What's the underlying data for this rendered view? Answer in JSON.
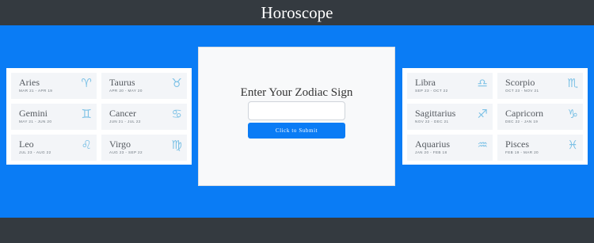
{
  "header": {
    "title": "Horoscope"
  },
  "left_panel": {
    "signs": [
      {
        "name": "Aries",
        "dates": "MAR 21 - APR 19",
        "glyph": "♈︎"
      },
      {
        "name": "Taurus",
        "dates": "APR 20 - MAY 20",
        "glyph": "♉︎"
      },
      {
        "name": "Gemini",
        "dates": "MAY 21 - JUN 20",
        "glyph": "♊︎"
      },
      {
        "name": "Cancer",
        "dates": "JUN 21 - JUL 22",
        "glyph": "♋︎"
      },
      {
        "name": "Leo",
        "dates": "JUL 23 - AUG 22",
        "glyph": "♌︎"
      },
      {
        "name": "Virgo",
        "dates": "AUG 23 - SEP 22",
        "glyph": "♍︎"
      }
    ]
  },
  "right_panel": {
    "signs": [
      {
        "name": "Libra",
        "dates": "SEP 23 - OCT 22",
        "glyph": "♎︎"
      },
      {
        "name": "Scorpio",
        "dates": "OCT 23 - NOV 21",
        "glyph": "♏︎"
      },
      {
        "name": "Sagittarius",
        "dates": "NOV 22 - DEC 21",
        "glyph": "♐︎"
      },
      {
        "name": "Capricorn",
        "dates": "DEC 22 - JAN 19",
        "glyph": "♑︎"
      },
      {
        "name": "Aquarius",
        "dates": "JAN 20 - FEB 18",
        "glyph": "♒︎"
      },
      {
        "name": "Pisces",
        "dates": "FEB 19 - MAR 20",
        "glyph": "♓︎"
      }
    ]
  },
  "form": {
    "heading": "Enter Your Zodiac Sign",
    "input_value": "",
    "input_placeholder": "",
    "submit_label": "Click to Submit"
  },
  "colors": {
    "background": "#0a7cf5",
    "navbar": "#343a40",
    "button": "#0a7cf5",
    "glyph": "#7ec2e6"
  }
}
